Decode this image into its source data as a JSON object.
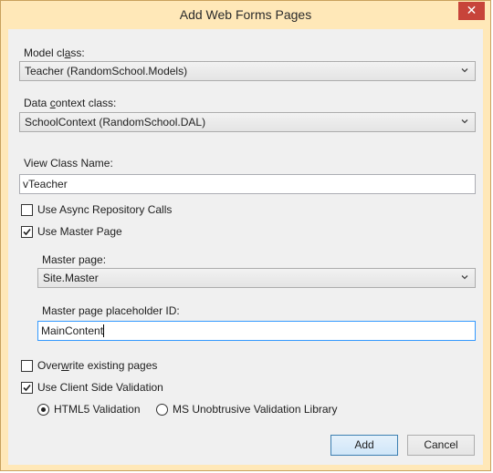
{
  "window": {
    "title": "Add Web Forms Pages",
    "close_glyph": "✕"
  },
  "model_class": {
    "label_pre": "Model cl",
    "label_u": "a",
    "label_post": "ss:",
    "value": "Teacher (RandomSchool.Models)"
  },
  "data_context": {
    "label_pre": "Data ",
    "label_u": "c",
    "label_post": "ontext class:",
    "value": "SchoolContext (RandomSchool.DAL)"
  },
  "view_class": {
    "label": "View Class Name:",
    "value": "vTeacher"
  },
  "options": {
    "async": {
      "label": "Use Async Repository Calls",
      "checked": false
    },
    "master": {
      "label": "Use Master Page",
      "checked": true
    }
  },
  "master_page": {
    "label": "Master page:",
    "value": "Site.Master"
  },
  "placeholder_id": {
    "label": "Master page placeholder ID:",
    "value": "MainContent"
  },
  "overwrite": {
    "label_pre": "Over",
    "label_u": "w",
    "label_post": "rite existing pages",
    "checked": false
  },
  "client_validation": {
    "label": "Use Client Side Validation",
    "checked": true
  },
  "validation_mode": {
    "html5": {
      "label": "HTML5 Validation",
      "selected": true
    },
    "ms": {
      "label": "MS Unobtrusive Validation Library",
      "selected": false
    }
  },
  "buttons": {
    "add": "Add",
    "cancel": "Cancel"
  },
  "colors": {
    "frame": "#ffe8b8",
    "close": "#c7443a",
    "focus": "#3399ff",
    "dialog_bg": "#f0f0f0"
  }
}
